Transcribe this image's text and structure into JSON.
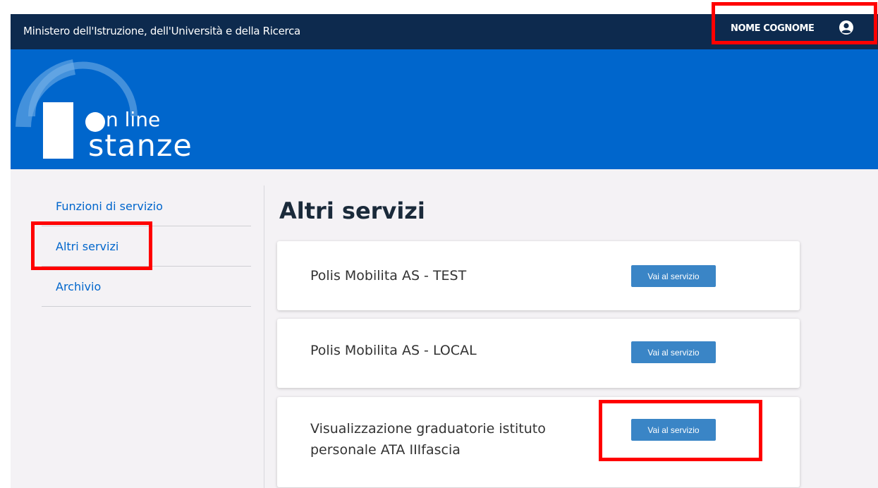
{
  "header": {
    "ministry": "Ministero dell'Istruzione, dell'Università e della Ricerca",
    "user_name": "NOME COGNOME",
    "user_icon": "user-circle-icon"
  },
  "logo": {
    "line1": "n line",
    "line2": "stanze"
  },
  "sidebar": {
    "items": [
      {
        "label": "Funzioni di servizio"
      },
      {
        "label": "Altri servizi"
      },
      {
        "label": "Archivio"
      }
    ]
  },
  "main": {
    "title": "Altri servizi",
    "services": [
      {
        "title": "Polis Mobilita AS - TEST",
        "button": "Vai al servizio"
      },
      {
        "title": "Polis Mobilita AS - LOCAL",
        "button": "Vai al servizio"
      },
      {
        "title": "Visualizzazione graduatorie istituto personale ATA IIIfascia",
        "button": "Vai al servizio"
      }
    ]
  },
  "colors": {
    "topbar": "#0d2a4e",
    "hero": "#0066cc",
    "button": "#3a85c6",
    "highlight": "#ff0000",
    "link": "#0066cc"
  }
}
